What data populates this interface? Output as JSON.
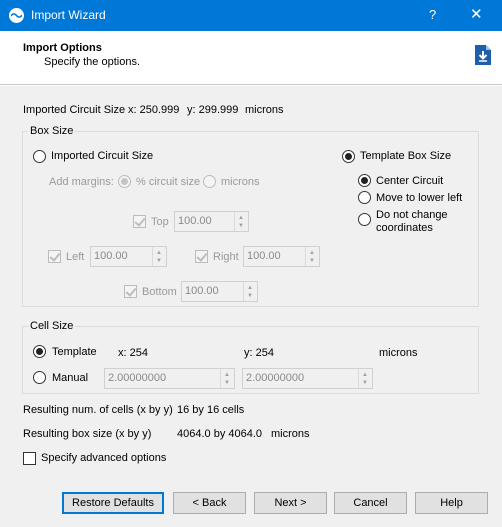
{
  "window": {
    "title": "Import Wizard",
    "help_glyph": "?",
    "close_glyph": "✕"
  },
  "header": {
    "title": "Import Options",
    "subtitle": "Specify the options."
  },
  "circuit_size": {
    "label": "Imported Circuit Size",
    "x": "x: 250.999",
    "y": "y: 299.999",
    "unit": "microns"
  },
  "box_size": {
    "group_label": "Box Size",
    "imported_option": "Imported Circuit Size",
    "template_option": "Template Box Size",
    "add_margins_label": "Add margins:",
    "pct_option": "% circuit size",
    "microns_option": "microns",
    "top": {
      "label": "Top",
      "value": "100.00"
    },
    "left": {
      "label": "Left",
      "value": "100.00"
    },
    "right": {
      "label": "Right",
      "value": "100.00"
    },
    "bottom": {
      "label": "Bottom",
      "value": "100.00"
    },
    "center_option": "Center Circuit",
    "lower_left_option": "Move to lower left",
    "no_change_line1": "Do not change",
    "no_change_line2": "coordinates"
  },
  "cell_size": {
    "group_label": "Cell Size",
    "template_option": "Template",
    "template_x": "x: 254",
    "template_y": "y: 254",
    "unit": "microns",
    "manual_option": "Manual",
    "manual_x": "2.00000000",
    "manual_y": "2.00000000"
  },
  "results": {
    "cells_label": "Resulting num. of cells (x by y)",
    "cells_value": "16 by 16 cells",
    "box_label": "Resulting box size (x by y)",
    "box_value": "4064.0 by 4064.0",
    "box_unit": "microns"
  },
  "advanced_option": "Specify advanced options",
  "buttons": {
    "restore": "Restore Defaults",
    "back": "< Back",
    "next": "Next >",
    "cancel": "Cancel",
    "help": "Help"
  },
  "colors": {
    "titlebar": "#0078d7",
    "dialog_bg": "#f0f0f0",
    "disabled_text": "#9a9a9a"
  }
}
